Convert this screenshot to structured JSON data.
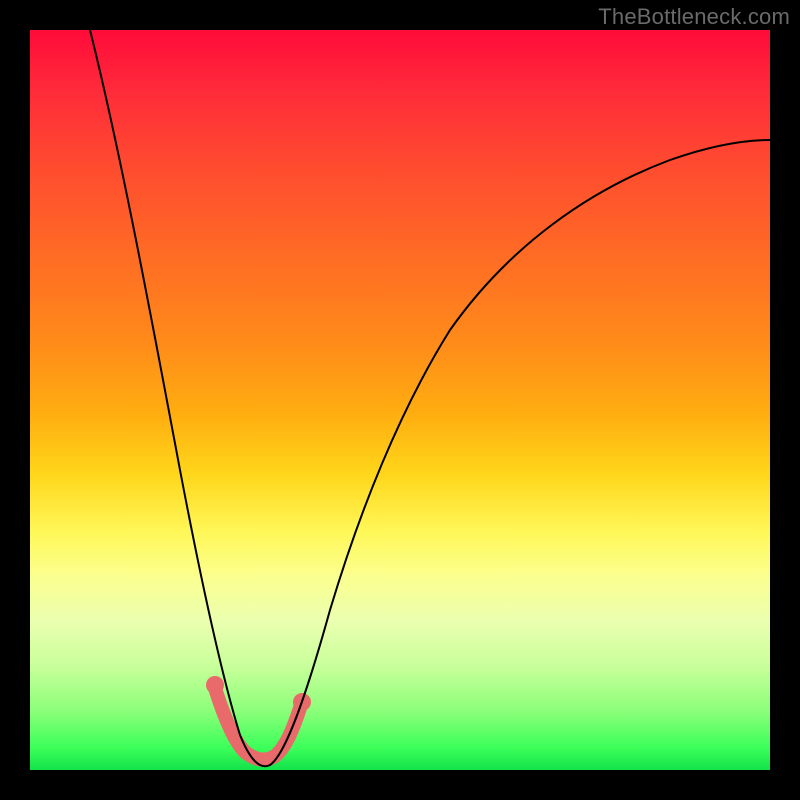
{
  "watermark": "TheBottleneck.com",
  "colors": {
    "page_bg": "#000000",
    "gradient_top": "#ff0b3a",
    "gradient_bottom": "#12e24a",
    "curve": "#000000",
    "marker": "#e86a6a",
    "watermark_text": "#6a6a6a"
  },
  "chart_data": {
    "type": "line",
    "title": "",
    "xlabel": "",
    "ylabel": "",
    "xlim": [
      0,
      100
    ],
    "ylim": [
      0,
      100
    ],
    "note": "Axes unlabeled; values are relative percentages of plot area. y=100 at top (red), y=0 at bottom (green). Curve depicts a V-shaped bottleneck profile with minimum near x≈28–33.",
    "series": [
      {
        "name": "bottleneck-curve",
        "x": [
          8,
          12,
          16,
          20,
          22,
          24,
          26,
          28,
          30,
          31,
          32,
          33,
          34,
          36,
          38,
          40,
          44,
          50,
          56,
          62,
          70,
          80,
          90,
          100
        ],
        "y": [
          100,
          88,
          72,
          52,
          40,
          28,
          16,
          8,
          3,
          2,
          2,
          3,
          6,
          12,
          20,
          28,
          40,
          52,
          60,
          66,
          72,
          78,
          82,
          84
        ]
      }
    ],
    "markers": {
      "name": "highlight-near-minimum",
      "x": [
        26,
        28,
        30,
        31,
        32,
        33,
        34,
        36
      ],
      "y": [
        12,
        6,
        3,
        2,
        2,
        3,
        5,
        10
      ]
    }
  }
}
